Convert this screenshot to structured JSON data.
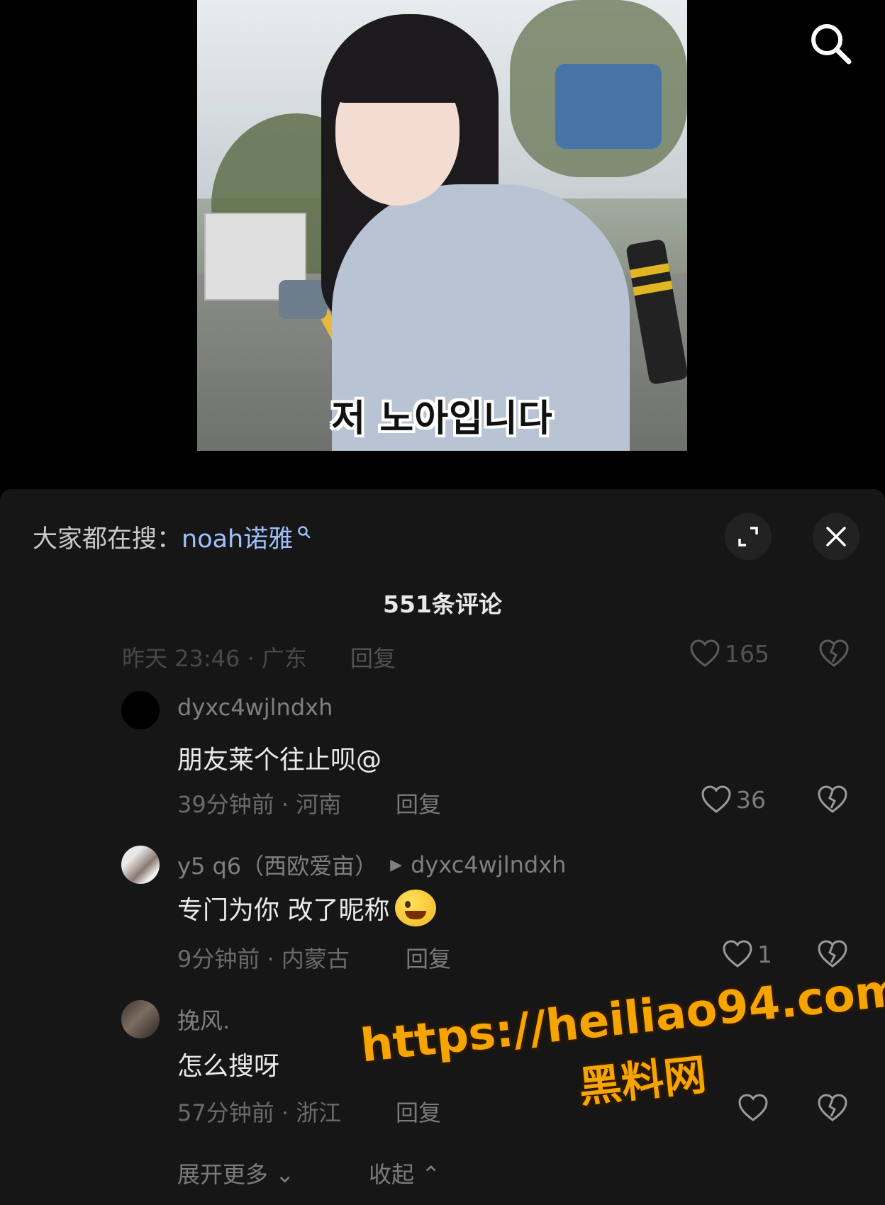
{
  "video": {
    "subtitle": "저 노아입니다"
  },
  "panel": {
    "trending_prefix": "大家都在搜：",
    "trending_keyword": "noah诺雅",
    "comment_count": "551条评论"
  },
  "top_meta": {
    "time": "昨天 23:46 · 广东",
    "reply": "回复",
    "likes": "165"
  },
  "comments": [
    {
      "username": "dyxc4wjlndxh",
      "reply_to": "",
      "text": "朋友莱个往止呗@",
      "time": "39分钟前 · 河南",
      "reply": "回复",
      "likes": "36"
    },
    {
      "username": "y5  q6（西欧爱亩）",
      "reply_to": "dyxc4wjlndxh",
      "text": "专门为你 改了昵称",
      "time": "9分钟前 · 内蒙古",
      "reply": "回复",
      "likes": "1"
    },
    {
      "username": "挽风.",
      "reply_to": "",
      "text": "怎么搜呀",
      "time": "57分钟前 · 浙江",
      "reply": "回复",
      "likes": ""
    }
  ],
  "footer": {
    "expand_more": "展开更多",
    "collapse": "收起"
  },
  "watermark": {
    "url": "https://heiliao94.com",
    "site": "黑料网"
  },
  "colors": {
    "panel_bg": "#161616",
    "keyword": "#9fc0ff",
    "watermark": "#f5a400"
  }
}
